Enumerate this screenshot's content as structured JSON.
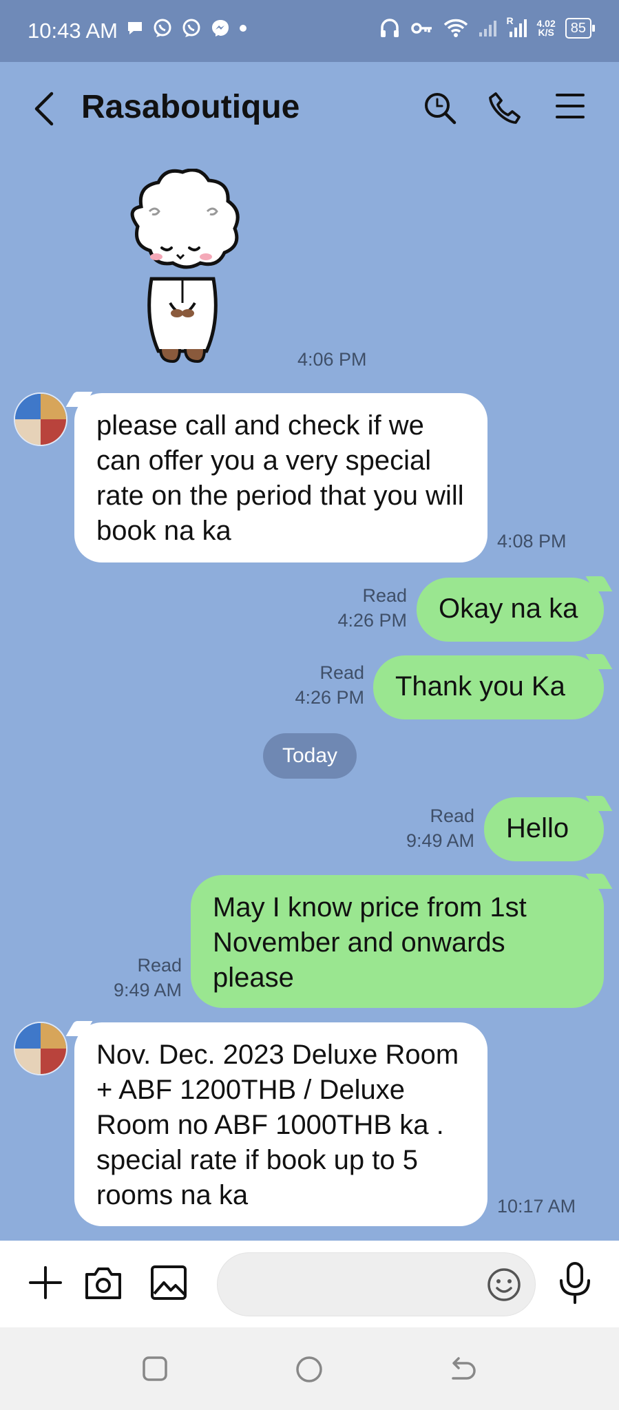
{
  "status_bar": {
    "time": "10:43 AM",
    "net_speed_value": "4.02",
    "net_speed_unit": "K/S",
    "roaming": "R",
    "battery": "85"
  },
  "header": {
    "title": "Rasaboutique"
  },
  "messages": [
    {
      "type": "sticker",
      "side": "in",
      "time": "4:06 PM"
    },
    {
      "type": "text",
      "side": "in",
      "text": "please call and check if we can offer you a very special rate on the period that you will book na ka",
      "time": "4:08 PM"
    },
    {
      "type": "text",
      "side": "out",
      "text": "Okay na ka",
      "status": "Read",
      "time": "4:26 PM"
    },
    {
      "type": "text",
      "side": "out",
      "text": "Thank you Ka",
      "status": "Read",
      "time": "4:26 PM"
    },
    {
      "type": "divider",
      "text": "Today"
    },
    {
      "type": "text",
      "side": "out",
      "text": "Hello",
      "status": "Read",
      "time": "9:49 AM"
    },
    {
      "type": "text",
      "side": "out",
      "text": "May I know price from 1st November and onwards please",
      "status": "Read",
      "time": "9:49 AM"
    },
    {
      "type": "text",
      "side": "in",
      "text": "Nov. Dec. 2023  Deluxe Room + ABF 1200THB / Deluxe Room no ABF 1000THB  ka . special rate if book up to  5 rooms na ka",
      "time": "10:17 AM"
    }
  ],
  "input": {
    "placeholder": ""
  }
}
